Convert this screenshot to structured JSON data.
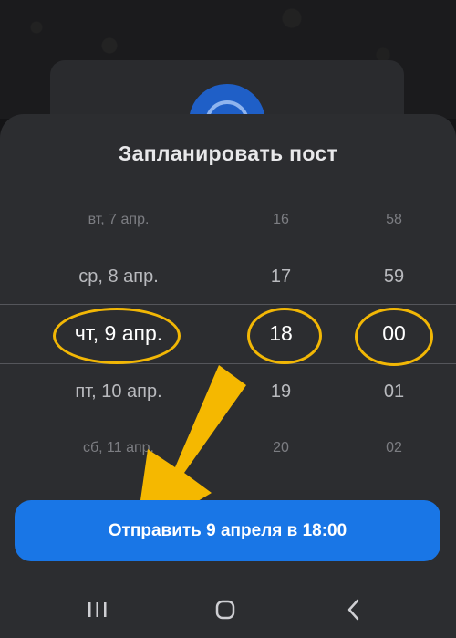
{
  "sheet": {
    "title": "Запланировать пост"
  },
  "picker": {
    "dates": [
      "вт, 7 апр.",
      "ср, 8 апр.",
      "чт, 9 апр.",
      "пт, 10 апр.",
      "сб, 11 апр."
    ],
    "hours": [
      "16",
      "17",
      "18",
      "19",
      "20"
    ],
    "minutes": [
      "58",
      "59",
      "00",
      "01",
      "02"
    ],
    "selected_index": 2
  },
  "send_button": {
    "label": "Отправить 9 апреля в 18:00"
  },
  "colors": {
    "accent": "#1976e6",
    "sheet_bg": "#2c2d30",
    "highlight": "#f2b705"
  },
  "navbar": {
    "icons": [
      "recent-apps-icon",
      "home-icon",
      "back-icon"
    ]
  }
}
